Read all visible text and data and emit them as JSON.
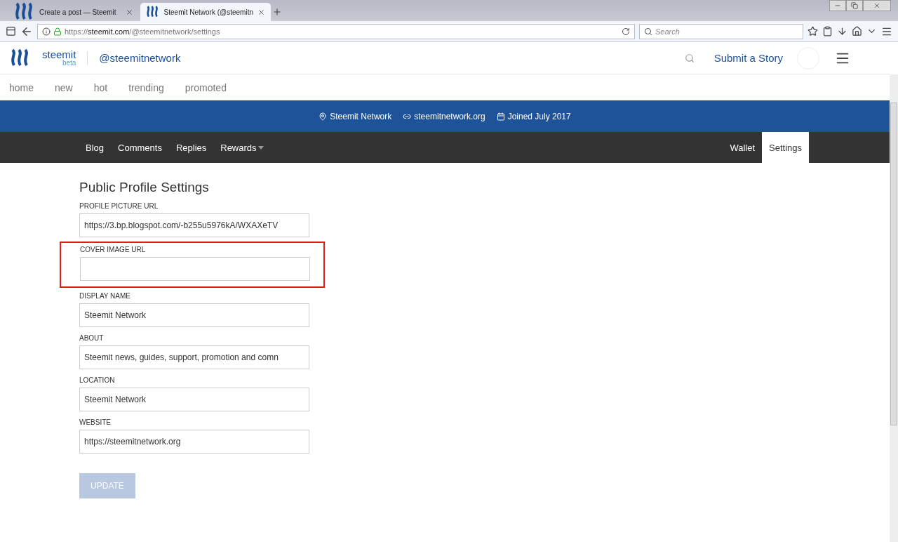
{
  "browser": {
    "tabs": [
      {
        "title": "Create a post — Steemit",
        "selected": false
      },
      {
        "title": "Steemit Network (@steemitn",
        "selected": true
      }
    ],
    "url_prefix": "https://",
    "url_host": "steemit.com",
    "url_path": "/@steemitnetwork/settings",
    "search": {
      "placeholder": "Search"
    }
  },
  "header": {
    "brand": "steemit",
    "brand_tag": "beta",
    "account": "@steemitnetwork",
    "submit": "Submit a Story"
  },
  "nav": [
    "home",
    "new",
    "hot",
    "trending",
    "promoted"
  ],
  "profile_bar": [
    {
      "kind": "location",
      "text": "Steemit Network"
    },
    {
      "kind": "link",
      "text": "steemitnetwork.org"
    },
    {
      "kind": "joined",
      "text": "Joined July 2017"
    }
  ],
  "profile_tabs": {
    "left": [
      {
        "label": "Blog",
        "selected": false,
        "dropdown": false
      },
      {
        "label": "Comments",
        "selected": false,
        "dropdown": false
      },
      {
        "label": "Replies",
        "selected": false,
        "dropdown": false
      },
      {
        "label": "Rewards",
        "selected": false,
        "dropdown": true
      }
    ],
    "right": [
      {
        "label": "Wallet",
        "selected": false,
        "dropdown": false
      },
      {
        "label": "Settings",
        "selected": true,
        "dropdown": false
      }
    ]
  },
  "settings": {
    "title": "Public Profile Settings",
    "fields": [
      {
        "label": "PROFILE PICTURE URL",
        "value": "https://3.bp.blogspot.com/-b255u5976kA/WXAXeTV",
        "highlighted": false
      },
      {
        "label": "COVER IMAGE URL",
        "highlighted": true
      },
      {
        "label": "DISPLAY NAME",
        "value": "Steemit Network",
        "highlighted": false
      },
      {
        "label": "ABOUT",
        "value": "Steemit news, guides, support, promotion and comn",
        "highlighted": false
      },
      {
        "label": "LOCATION",
        "value": "Steemit Network",
        "highlighted": false
      },
      {
        "label": "WEBSITE",
        "value": "https://steemitnetwork.org",
        "highlighted": false
      }
    ],
    "button": {
      "label": "UPDATE",
      "disabled": true
    }
  }
}
